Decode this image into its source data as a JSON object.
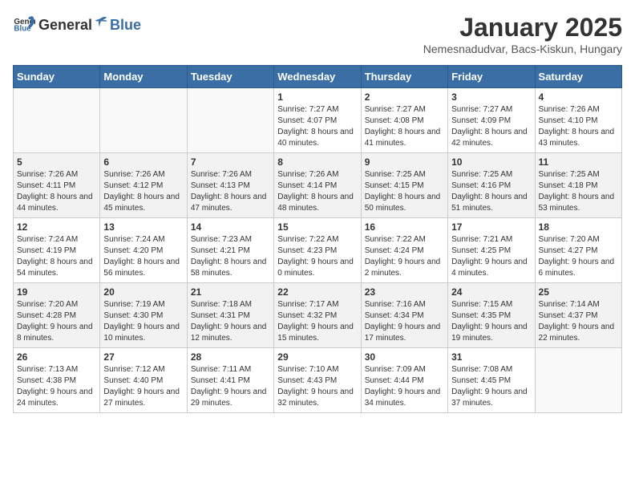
{
  "header": {
    "logo_general": "General",
    "logo_blue": "Blue",
    "title": "January 2025",
    "subtitle": "Nemesnadudvar, Bacs-Kiskun, Hungary"
  },
  "weekdays": [
    "Sunday",
    "Monday",
    "Tuesday",
    "Wednesday",
    "Thursday",
    "Friday",
    "Saturday"
  ],
  "weeks": [
    [
      {
        "day": "",
        "info": ""
      },
      {
        "day": "",
        "info": ""
      },
      {
        "day": "",
        "info": ""
      },
      {
        "day": "1",
        "info": "Sunrise: 7:27 AM\nSunset: 4:07 PM\nDaylight: 8 hours and 40 minutes."
      },
      {
        "day": "2",
        "info": "Sunrise: 7:27 AM\nSunset: 4:08 PM\nDaylight: 8 hours and 41 minutes."
      },
      {
        "day": "3",
        "info": "Sunrise: 7:27 AM\nSunset: 4:09 PM\nDaylight: 8 hours and 42 minutes."
      },
      {
        "day": "4",
        "info": "Sunrise: 7:26 AM\nSunset: 4:10 PM\nDaylight: 8 hours and 43 minutes."
      }
    ],
    [
      {
        "day": "5",
        "info": "Sunrise: 7:26 AM\nSunset: 4:11 PM\nDaylight: 8 hours and 44 minutes."
      },
      {
        "day": "6",
        "info": "Sunrise: 7:26 AM\nSunset: 4:12 PM\nDaylight: 8 hours and 45 minutes."
      },
      {
        "day": "7",
        "info": "Sunrise: 7:26 AM\nSunset: 4:13 PM\nDaylight: 8 hours and 47 minutes."
      },
      {
        "day": "8",
        "info": "Sunrise: 7:26 AM\nSunset: 4:14 PM\nDaylight: 8 hours and 48 minutes."
      },
      {
        "day": "9",
        "info": "Sunrise: 7:25 AM\nSunset: 4:15 PM\nDaylight: 8 hours and 50 minutes."
      },
      {
        "day": "10",
        "info": "Sunrise: 7:25 AM\nSunset: 4:16 PM\nDaylight: 8 hours and 51 minutes."
      },
      {
        "day": "11",
        "info": "Sunrise: 7:25 AM\nSunset: 4:18 PM\nDaylight: 8 hours and 53 minutes."
      }
    ],
    [
      {
        "day": "12",
        "info": "Sunrise: 7:24 AM\nSunset: 4:19 PM\nDaylight: 8 hours and 54 minutes."
      },
      {
        "day": "13",
        "info": "Sunrise: 7:24 AM\nSunset: 4:20 PM\nDaylight: 8 hours and 56 minutes."
      },
      {
        "day": "14",
        "info": "Sunrise: 7:23 AM\nSunset: 4:21 PM\nDaylight: 8 hours and 58 minutes."
      },
      {
        "day": "15",
        "info": "Sunrise: 7:22 AM\nSunset: 4:23 PM\nDaylight: 9 hours and 0 minutes."
      },
      {
        "day": "16",
        "info": "Sunrise: 7:22 AM\nSunset: 4:24 PM\nDaylight: 9 hours and 2 minutes."
      },
      {
        "day": "17",
        "info": "Sunrise: 7:21 AM\nSunset: 4:25 PM\nDaylight: 9 hours and 4 minutes."
      },
      {
        "day": "18",
        "info": "Sunrise: 7:20 AM\nSunset: 4:27 PM\nDaylight: 9 hours and 6 minutes."
      }
    ],
    [
      {
        "day": "19",
        "info": "Sunrise: 7:20 AM\nSunset: 4:28 PM\nDaylight: 9 hours and 8 minutes."
      },
      {
        "day": "20",
        "info": "Sunrise: 7:19 AM\nSunset: 4:30 PM\nDaylight: 9 hours and 10 minutes."
      },
      {
        "day": "21",
        "info": "Sunrise: 7:18 AM\nSunset: 4:31 PM\nDaylight: 9 hours and 12 minutes."
      },
      {
        "day": "22",
        "info": "Sunrise: 7:17 AM\nSunset: 4:32 PM\nDaylight: 9 hours and 15 minutes."
      },
      {
        "day": "23",
        "info": "Sunrise: 7:16 AM\nSunset: 4:34 PM\nDaylight: 9 hours and 17 minutes."
      },
      {
        "day": "24",
        "info": "Sunrise: 7:15 AM\nSunset: 4:35 PM\nDaylight: 9 hours and 19 minutes."
      },
      {
        "day": "25",
        "info": "Sunrise: 7:14 AM\nSunset: 4:37 PM\nDaylight: 9 hours and 22 minutes."
      }
    ],
    [
      {
        "day": "26",
        "info": "Sunrise: 7:13 AM\nSunset: 4:38 PM\nDaylight: 9 hours and 24 minutes."
      },
      {
        "day": "27",
        "info": "Sunrise: 7:12 AM\nSunset: 4:40 PM\nDaylight: 9 hours and 27 minutes."
      },
      {
        "day": "28",
        "info": "Sunrise: 7:11 AM\nSunset: 4:41 PM\nDaylight: 9 hours and 29 minutes."
      },
      {
        "day": "29",
        "info": "Sunrise: 7:10 AM\nSunset: 4:43 PM\nDaylight: 9 hours and 32 minutes."
      },
      {
        "day": "30",
        "info": "Sunrise: 7:09 AM\nSunset: 4:44 PM\nDaylight: 9 hours and 34 minutes."
      },
      {
        "day": "31",
        "info": "Sunrise: 7:08 AM\nSunset: 4:45 PM\nDaylight: 9 hours and 37 minutes."
      },
      {
        "day": "",
        "info": ""
      }
    ]
  ]
}
